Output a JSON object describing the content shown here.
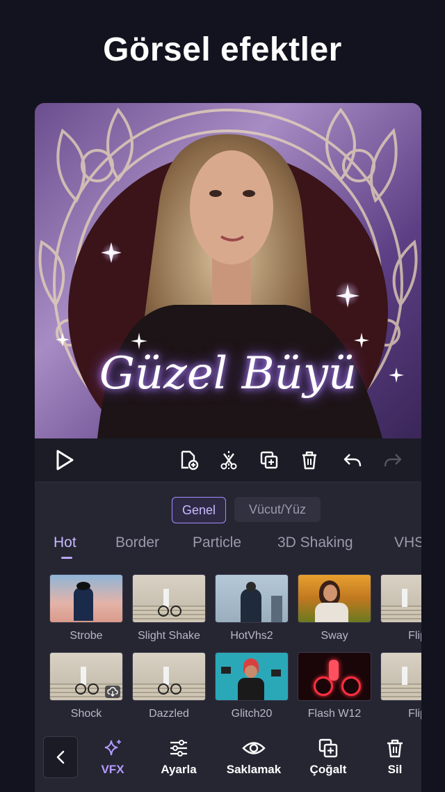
{
  "headline": "Görsel efektler",
  "preview": {
    "overlay_text": "Güzel Büyü"
  },
  "toolbar": {
    "icons": [
      "play-icon",
      "add-clip-icon",
      "split-icon",
      "duplicate-icon",
      "delete-icon",
      "undo-icon",
      "redo-icon"
    ]
  },
  "segments": {
    "active": "Genel",
    "inactive": "Vücut/Yüz"
  },
  "categories": [
    "Hot",
    "Border",
    "Particle",
    "3D Shaking",
    "VHS"
  ],
  "effects": [
    {
      "label": "Strobe"
    },
    {
      "label": "Slight Shake"
    },
    {
      "label": "HotVhs2"
    },
    {
      "label": "Sway"
    },
    {
      "label": "Flip"
    },
    {
      "label": "Shock",
      "download": true
    },
    {
      "label": "Dazzled"
    },
    {
      "label": "Glitch20"
    },
    {
      "label": "Flash W12"
    },
    {
      "label": "Flip"
    }
  ],
  "bottom_nav": {
    "vfx": "VFX",
    "adjust": "Ayarla",
    "hide": "Saklamak",
    "duplicate": "Çoğalt",
    "delete": "Sil"
  },
  "colors": {
    "background": "#13131f",
    "panel": "#262633",
    "accent": "#b49cff"
  }
}
